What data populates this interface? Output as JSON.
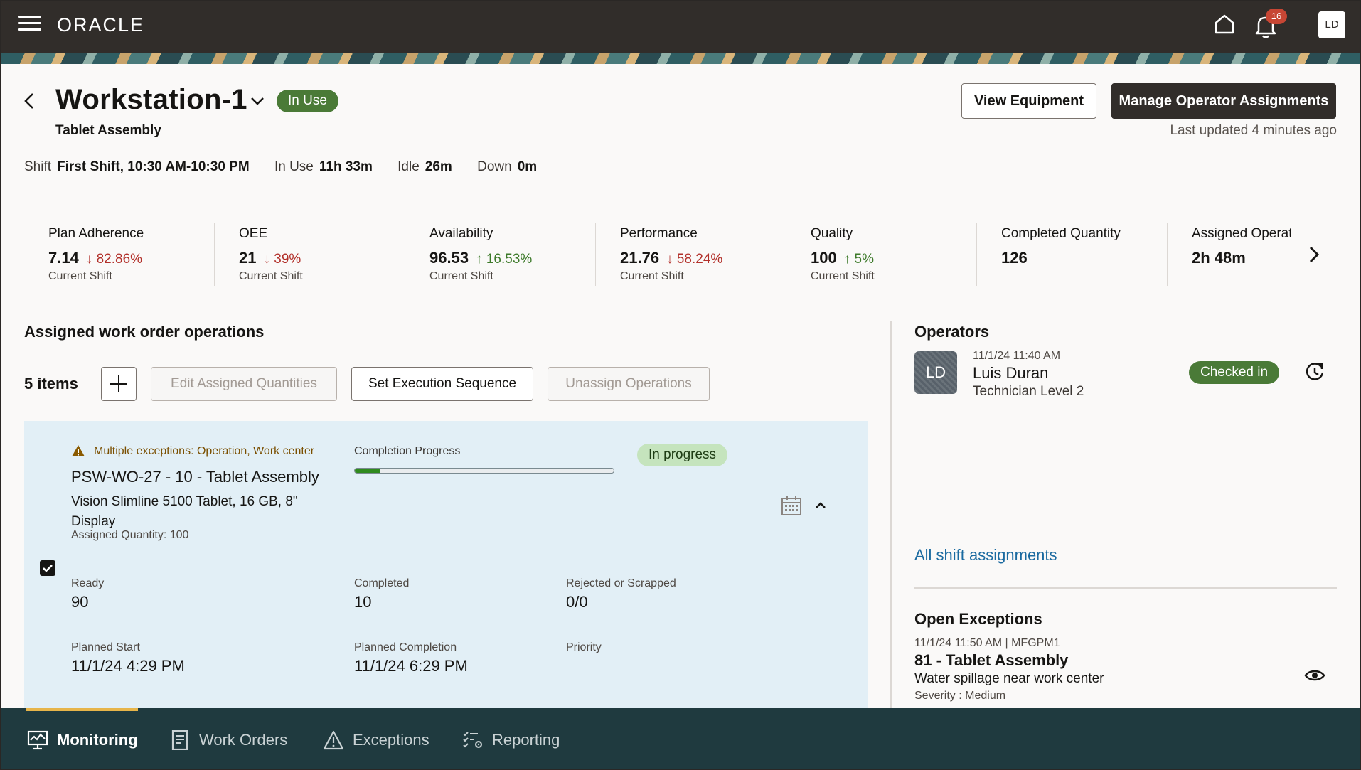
{
  "header": {
    "logo": "ORACLE",
    "notification_count": "16",
    "user_initials": "LD"
  },
  "page": {
    "title": "Workstation-1",
    "status": "In Use",
    "subtitle": "Tablet Assembly",
    "view_equipment_label": "View Equipment",
    "manage_assignments_label": "Manage Operator Assignments",
    "last_updated": "Last updated 4 minutes ago"
  },
  "shift": {
    "shift_label": "Shift",
    "shift_value": "First Shift, 10:30 AM-10:30 PM",
    "inuse_label": "In Use",
    "inuse_value": "11h 33m",
    "idle_label": "Idle",
    "idle_value": "26m",
    "down_label": "Down",
    "down_value": "0m"
  },
  "kpis": [
    {
      "name": "Plan Adherence",
      "value": "7.14",
      "delta": "82.86%",
      "direction": "down",
      "footer": "Current Shift"
    },
    {
      "name": "OEE",
      "value": "21",
      "delta": "39%",
      "direction": "down",
      "footer": "Current Shift"
    },
    {
      "name": "Availability",
      "value": "96.53",
      "delta": "16.53%",
      "direction": "up",
      "footer": "Current Shift"
    },
    {
      "name": "Performance",
      "value": "21.76",
      "delta": "58.24%",
      "direction": "down",
      "footer": "Current Shift"
    },
    {
      "name": "Quality",
      "value": "100",
      "delta": "5%",
      "direction": "up",
      "footer": "Current Shift"
    },
    {
      "name": "Completed Quantity",
      "value": "126",
      "delta": "",
      "direction": "",
      "footer": ""
    },
    {
      "name": "Assigned Operat",
      "value": "2h 48m",
      "delta": "",
      "direction": "",
      "footer": ""
    }
  ],
  "operations": {
    "section_title": "Assigned work order operations",
    "count": "5 items",
    "edit_qty_label": "Edit Assigned Quantities",
    "set_sequence_label": "Set Execution Sequence",
    "unassign_label": "Unassign Operations",
    "card": {
      "exception": "Multiple exceptions: Operation, Work center",
      "title": "PSW-WO-27 - 10 - Tablet Assembly",
      "description": "Vision Slimline 5100 Tablet, 16 GB, 8\" Display",
      "assigned_qty": "Assigned Quantity: 100",
      "progress_label": "Completion Progress",
      "progress_fraction": 0.1,
      "status": "In progress",
      "ready_label": "Ready",
      "ready_value": "90",
      "completed_label": "Completed",
      "completed_value": "10",
      "rejected_label": "Rejected or Scrapped",
      "rejected_value": "0/0",
      "planned_start_label": "Planned Start",
      "planned_start_value": "11/1/24 4:29 PM",
      "planned_completion_label": "Planned Completion",
      "planned_completion_value": "11/1/24 6:29 PM",
      "priority_label": "Priority"
    }
  },
  "operators": {
    "section_title": "Operators",
    "operator": {
      "initials": "LD",
      "time": "11/1/24 11:40 AM",
      "name": "Luis Duran",
      "role": "Technician Level 2",
      "status": "Checked in"
    },
    "all_assignments_link": "All shift assignments"
  },
  "exceptions": {
    "section_title": "Open Exceptions",
    "item": {
      "meta": "11/1/24 11:50 AM | MFGPM1",
      "title": "81 - Tablet Assembly",
      "description": "Water spillage near work center",
      "severity": "Severity : Medium"
    }
  },
  "bottom_nav": [
    {
      "label": "Monitoring",
      "icon": "monitor-icon",
      "active": true
    },
    {
      "label": "Work Orders",
      "icon": "document-icon",
      "active": false
    },
    {
      "label": "Exceptions",
      "icon": "warning-icon",
      "active": false
    },
    {
      "label": "Reporting",
      "icon": "checklist-gear-icon",
      "active": false
    }
  ],
  "colors": {
    "header_bg": "#312d2a",
    "status_green": "#4a7a37",
    "delta_down": "#b2302a",
    "delta_up": "#3d7a2a",
    "card_bg": "#e2eff6",
    "nav_bg": "#1f3a3f",
    "nav_accent": "#e7b54a",
    "link": "#1a6aa0"
  }
}
